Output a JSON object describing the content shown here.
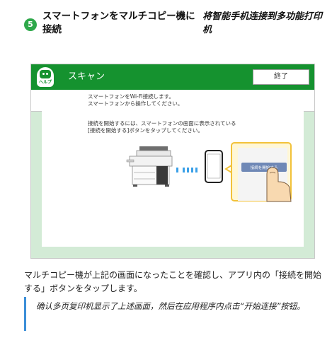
{
  "step": {
    "number": "5",
    "title_ja": "スマートフォンをマルチコピー機に接続",
    "title_zh": "将智能手机连接到多功能打印机"
  },
  "screen": {
    "help_label": "ヘルプ",
    "title": "スキャン",
    "end_button": "終了",
    "info_lines": [
      "スマートフォンをWi-Fi接続します。",
      "スマートフォンから操作してください。"
    ],
    "card_lines": [
      "接続を開始するには、スマートフォンの画面に表示されている",
      "[接続を開始する]ボタンをタップしてください。"
    ],
    "phone_button": "接続を開始する"
  },
  "description_ja": "マルチコピー機が上記の画面になったことを確認し、アプリ内の「接続を開始する」ボタンをタップします。",
  "note_zh": "确认多页复印机显示了上述画面，然后在应用程序内点击“开始连接”按钮。",
  "colors": {
    "topbar": "#15922f",
    "panel_bg": "#d3ebd6",
    "badge": "#2ea84a",
    "wave": "#3aa0e8",
    "accent_frame": "#f2c23a",
    "quote_bar": "#3b8ed8"
  },
  "icons": [
    "help-icon",
    "copier-icon",
    "wifi-waves-icon",
    "smartphone-icon",
    "finger-tap-icon"
  ]
}
